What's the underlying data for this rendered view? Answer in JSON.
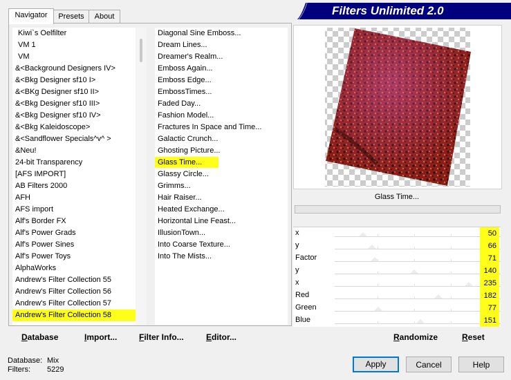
{
  "tabs": [
    {
      "label": "Navigator",
      "active": true
    },
    {
      "label": "Presets",
      "active": false
    },
    {
      "label": "About",
      "active": false
    }
  ],
  "banner_title": "Filters Unlimited 2.0",
  "categories": [
    "Kiwi`s Oelfilter",
    "VM 1",
    "VM",
    "&<Background Designers IV>",
    "&<Bkg Designer sf10 I>",
    "&<BKg Designer sf10 II>",
    "&<Bkg Designer sf10 III>",
    "&<Bkg Designer sf10 IV>",
    "&<Bkg Kaleidoscope>",
    "&<Sandflower Specials^v^ >",
    "&Neu!",
    "24-bit Transparency",
    "[AFS IMPORT]",
    "AB Filters 2000",
    "AFH",
    "AFS import",
    "Alf's Border FX",
    "Alf's Power Grads",
    "Alf's Power Sines",
    "Alf's Power Toys",
    "AlphaWorks",
    "Andrew's Filter Collection 55",
    "Andrew's Filter Collection 56",
    "Andrew's Filter Collection 57",
    "Andrew's Filter Collection 58"
  ],
  "selected_category": "Andrew's Filter Collection 58",
  "filters": [
    "Diagonal Sine Emboss...",
    "Dream Lines...",
    "Dreamer's Realm...",
    "Emboss Again...",
    "Emboss Edge...",
    "EmbossTimes...",
    "Faded Day...",
    "Fashion Model...",
    "Fractures In Space and Time...",
    "Galactic Crunch...",
    "Ghosting Picture...",
    "Glass Time...",
    "Glassy Circle...",
    "Grimms...",
    "Hair Raiser...",
    "Heated Exchange...",
    "Horizontal Line Feast...",
    "IllusionTown...",
    "Into Coarse Texture...",
    "Into The Mists..."
  ],
  "selected_filter": "Glass Time...",
  "preview_label": "Glass Time...",
  "sliders": [
    {
      "label": "x",
      "value": 50
    },
    {
      "label": "y",
      "value": 66
    },
    {
      "label": "Factor",
      "value": 71
    },
    {
      "label": "y",
      "value": 140
    },
    {
      "label": "x",
      "value": 235
    },
    {
      "label": "Red",
      "value": 182
    },
    {
      "label": "Green",
      "value": 77
    },
    {
      "label": "Blue",
      "value": 151
    }
  ],
  "left_buttons": {
    "database": "Database",
    "import": "Import...",
    "filter_info": "Filter Info...",
    "editor": "Editor..."
  },
  "right_buttons": {
    "randomize": "Randomize",
    "reset": "Reset"
  },
  "footer": {
    "database_label": "Database:",
    "database_value": "Mix",
    "filters_label": "Filters:",
    "filters_value": "5229"
  },
  "dialog_buttons": {
    "apply": "Apply",
    "cancel": "Cancel",
    "help": "Help"
  },
  "colors": {
    "highlight": "#ffff1a",
    "banner": "#00007f",
    "accent": "#0078d7"
  }
}
